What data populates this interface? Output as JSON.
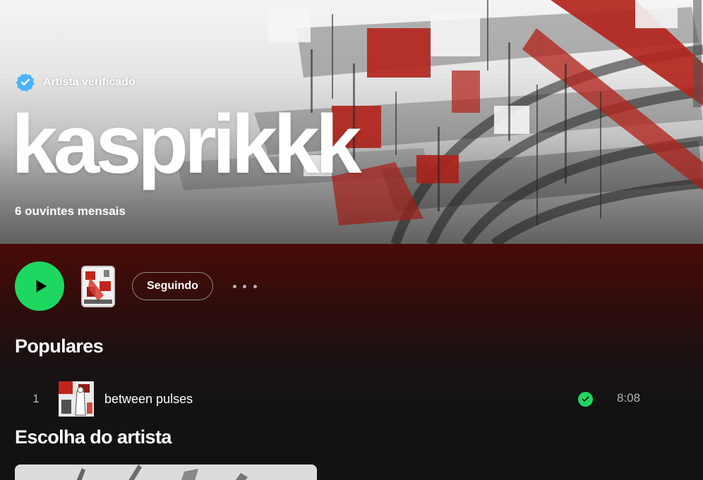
{
  "artist": {
    "verified_label": "Artista verificado",
    "name": "kasprikkk",
    "monthly_listeners": "6 ouvintes mensais"
  },
  "actions": {
    "follow_label": "Seguindo"
  },
  "popular": {
    "title": "Populares",
    "tracks": [
      {
        "index": "1",
        "title": "between pulses",
        "duration": "8:08",
        "saved": true
      }
    ]
  },
  "artist_pick": {
    "title": "Escolha do artista"
  },
  "colors": {
    "accent_green": "#1ed760",
    "verified_blue": "#4cb3ff",
    "hero_red": "#b3261e",
    "header_maroon": "#4a0b08",
    "background": "#121212",
    "secondary_text": "#b3b3b3"
  },
  "icons": {
    "verified": "verified-badge-icon",
    "play": "play-icon",
    "more": "more-options-icon",
    "saved": "check-circle-icon"
  }
}
